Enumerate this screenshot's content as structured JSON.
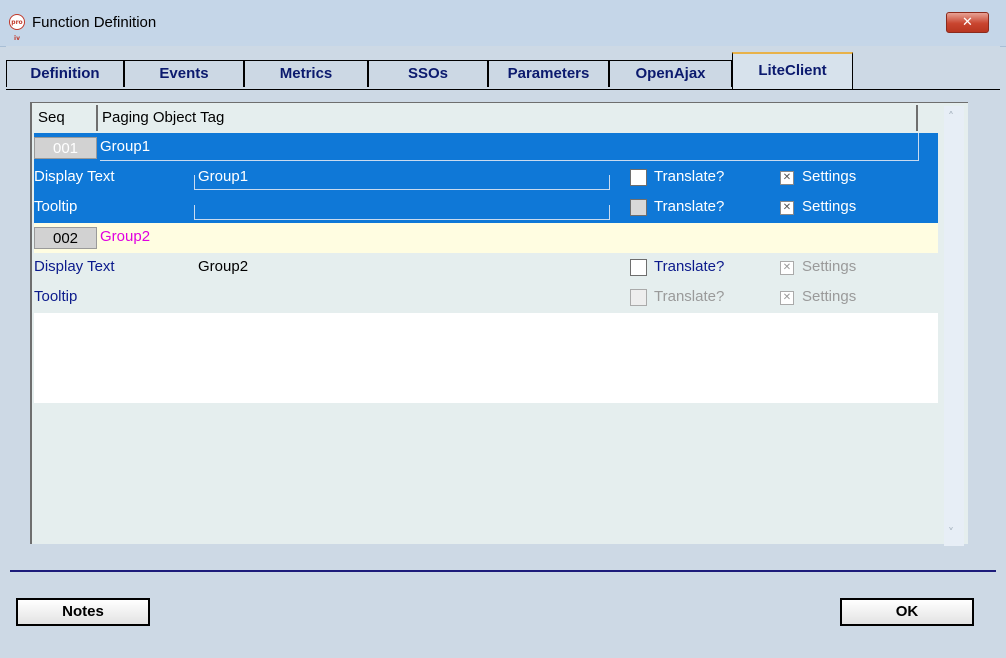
{
  "window": {
    "app_icon_text": "pro iv",
    "title": "Function Definition",
    "close_glyph": "✕"
  },
  "tabs": [
    {
      "label": "Definition",
      "active": false
    },
    {
      "label": "Events",
      "active": false
    },
    {
      "label": "Metrics",
      "active": false
    },
    {
      "label": "SSOs",
      "active": false
    },
    {
      "label": "Parameters",
      "active": false
    },
    {
      "label": "OpenAjax",
      "active": false
    },
    {
      "label": "LiteClient",
      "active": true
    }
  ],
  "grid": {
    "headers": {
      "seq": "Seq",
      "tag": "Paging Object Tag"
    },
    "groups": [
      {
        "seq": "001",
        "tag": "Group1",
        "selected": true,
        "display_text": {
          "label": "Display Text",
          "value": "Group1",
          "translate_label": "Translate?",
          "translate_checked": false,
          "translate_enabled": true,
          "settings_label": "Settings",
          "settings_checked": true,
          "settings_enabled": true
        },
        "tooltip": {
          "label": "Tooltip",
          "value": "",
          "translate_label": "Translate?",
          "translate_checked": false,
          "translate_enabled": false,
          "settings_label": "Settings",
          "settings_checked": true,
          "settings_enabled": true
        }
      },
      {
        "seq": "002",
        "tag": "Group2",
        "selected": false,
        "display_text": {
          "label": "Display Text",
          "value": "Group2",
          "translate_label": "Translate?",
          "translate_checked": false,
          "translate_enabled": true,
          "settings_label": "Settings",
          "settings_checked": true,
          "settings_enabled": false
        },
        "tooltip": {
          "label": "Tooltip",
          "value": "",
          "translate_label": "Translate?",
          "translate_checked": false,
          "translate_enabled": false,
          "settings_label": "Settings",
          "settings_checked": true,
          "settings_enabled": false
        }
      }
    ]
  },
  "buttons": {
    "notes": "Notes",
    "ok": "OK"
  },
  "colors": {
    "selection": "#0f78d7",
    "group2_tag": "#e000e0",
    "label_blue": "#0b1a8c",
    "group2_row_bg": "#fffde1",
    "tab_active_accent": "#e8b24a"
  }
}
